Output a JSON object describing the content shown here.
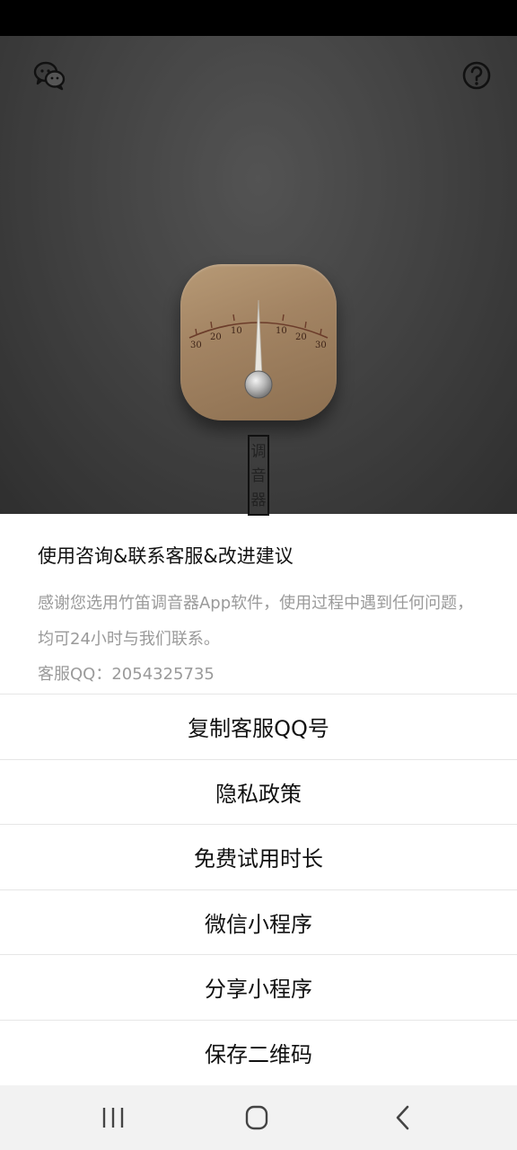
{
  "dial": {
    "scale_labels": [
      "30",
      "20",
      "10",
      "10",
      "20",
      "30"
    ]
  },
  "vertical_label": {
    "chars": [
      "调",
      "音",
      "器"
    ]
  },
  "sheet": {
    "title": "使用咨询&联系客服&改进建议",
    "description": "感谢您选用竹笛调音器App软件，使用过程中遇到任何问题，均可24小时与我们联系。",
    "qq": "客服QQ：2054325735",
    "menu": [
      {
        "label": "复制客服QQ号"
      },
      {
        "label": "隐私政策"
      },
      {
        "label": "免费试用时长"
      },
      {
        "label": "微信小程序"
      },
      {
        "label": "分享小程序"
      },
      {
        "label": "保存二维码"
      }
    ]
  },
  "icons": {
    "top_left": "wechat-icon",
    "top_right": "help-icon",
    "nav_recents": "recents-icon",
    "nav_home": "home-icon",
    "nav_back": "back-icon"
  },
  "colors": {
    "sheet_bg": "#ffffff",
    "secondary_text": "#9a9a9a",
    "dial_wood": "#a38463"
  }
}
